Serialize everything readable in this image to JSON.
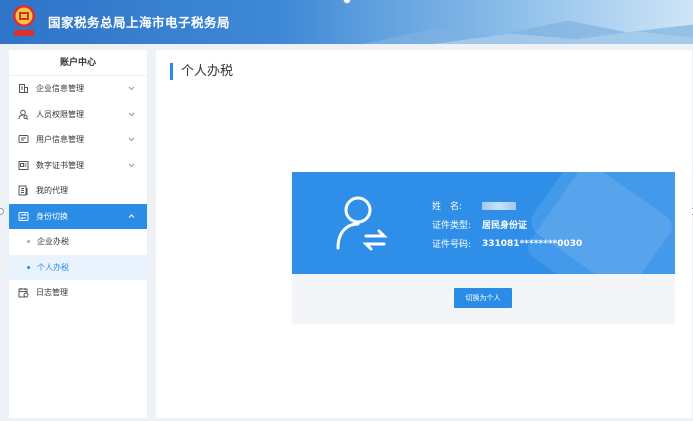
{
  "header": {
    "title": "国家税务总局上海市电子税务局",
    "logo_caption": "中国税务"
  },
  "sidebar": {
    "title": "账户中心",
    "items": [
      {
        "label": "企业信息管理",
        "icon": "building-icon",
        "expandable": true
      },
      {
        "label": "人员权限管理",
        "icon": "user-search-icon",
        "expandable": true
      },
      {
        "label": "用户信息管理",
        "icon": "message-icon",
        "expandable": true
      },
      {
        "label": "数字证书管理",
        "icon": "certificate-icon",
        "expandable": true
      },
      {
        "label": "我的代理",
        "icon": "list-icon",
        "expandable": false
      },
      {
        "label": "身份切换",
        "icon": "switch-icon",
        "expandable": true,
        "active": true,
        "children": [
          {
            "label": "企业办税"
          },
          {
            "label": "个人办税",
            "selected": true
          }
        ]
      },
      {
        "label": "日志管理",
        "icon": "calendar-icon",
        "expandable": false
      }
    ]
  },
  "main": {
    "page_title": "个人办税",
    "card": {
      "name_label": "姓　名:",
      "id_type_label": "证件类型:",
      "id_type_value": "居民身份证",
      "id_number_label": "证件号码:",
      "id_number_value": "331081********0030",
      "switch_button": "切换为个人"
    }
  },
  "colors": {
    "accent": "#2b8ce6",
    "card_blue": "#2f8fe8",
    "header_blue": "#2f74c8"
  }
}
